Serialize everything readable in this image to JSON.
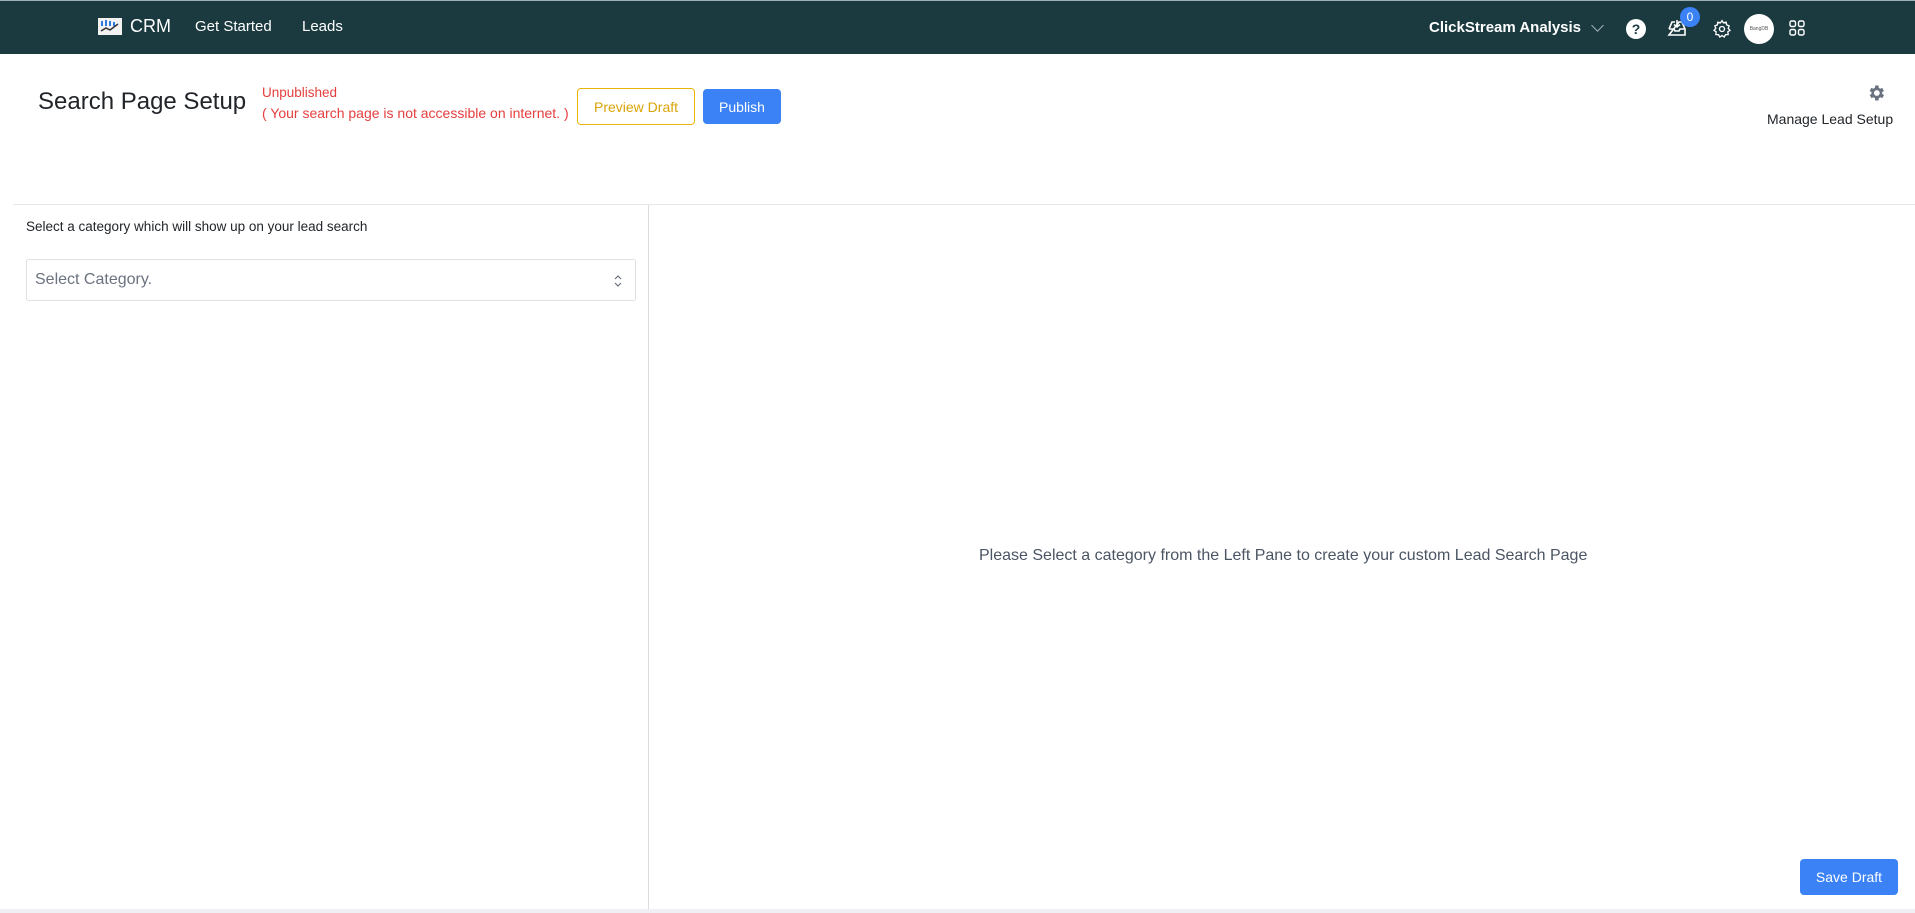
{
  "topbar": {
    "brand": "CRM",
    "nav": [
      {
        "label": "Get Started"
      },
      {
        "label": "Leads"
      }
    ],
    "org_switcher": "ClickStream Analysis",
    "help_glyph": "?",
    "notifications_count": "0",
    "avatar_text": "BangDB",
    "icons": [
      "help-icon",
      "inbox-download-icon",
      "gear-icon",
      "avatar",
      "apps-grid-icon"
    ]
  },
  "header": {
    "title": "Search Page Setup",
    "status": "Unpublished",
    "status_note": "( Your search page is not accessible on internet. )",
    "preview_label": "Preview Draft",
    "publish_label": "Publish",
    "manage_label": "Manage Lead Setup"
  },
  "left_pane": {
    "instruction": "Select a category which will show up on your lead search",
    "select_placeholder": "Select Category."
  },
  "right_pane": {
    "empty_message": "Please Select a category from the Left Pane to create your custom Lead Search Page"
  },
  "footer": {
    "save_label": "Save Draft"
  },
  "colors": {
    "topbar_bg": "#1b3a40",
    "primary": "#3b82f6",
    "warning": "#eab308",
    "danger": "#e53e3e"
  }
}
